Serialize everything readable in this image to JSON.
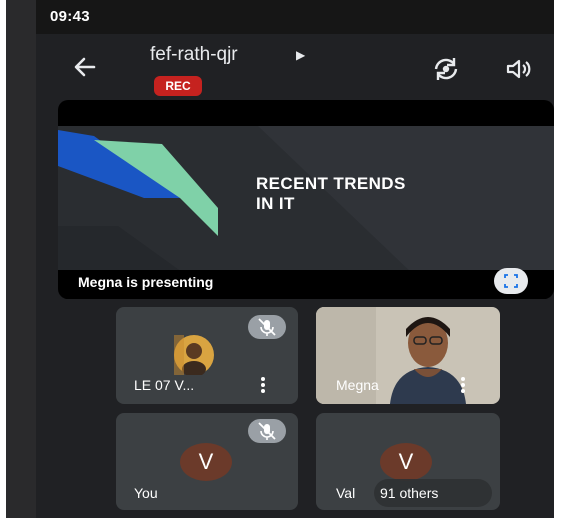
{
  "status": {
    "time": "09:43"
  },
  "header": {
    "meeting_code": "fef-rath-qjr",
    "rec_badge": "REC",
    "icons": [
      "back-arrow-icon",
      "switch-camera-icon",
      "speaker-icon"
    ]
  },
  "presentation": {
    "slide_title_line1": "RECENT TRENDS",
    "slide_title_line2": "IN IT",
    "presenter_label": "Megna is presenting"
  },
  "participants": [
    {
      "name": "LE 07 V...",
      "muted": true,
      "media": "photo-avatar"
    },
    {
      "name": "Megna",
      "muted": false,
      "media": "video"
    },
    {
      "name": "You",
      "muted": true,
      "avatar_letter": "V"
    },
    {
      "name": "Val",
      "avatar_letter": "V",
      "others_label": "91 others"
    }
  ],
  "colors": {
    "background": "#202124",
    "tile": "#3c4043",
    "rec": "#c5221f",
    "avatar": "#6b3a2a",
    "slide_blue": "#1a56c4",
    "slide_green": "#7fd1a8"
  }
}
